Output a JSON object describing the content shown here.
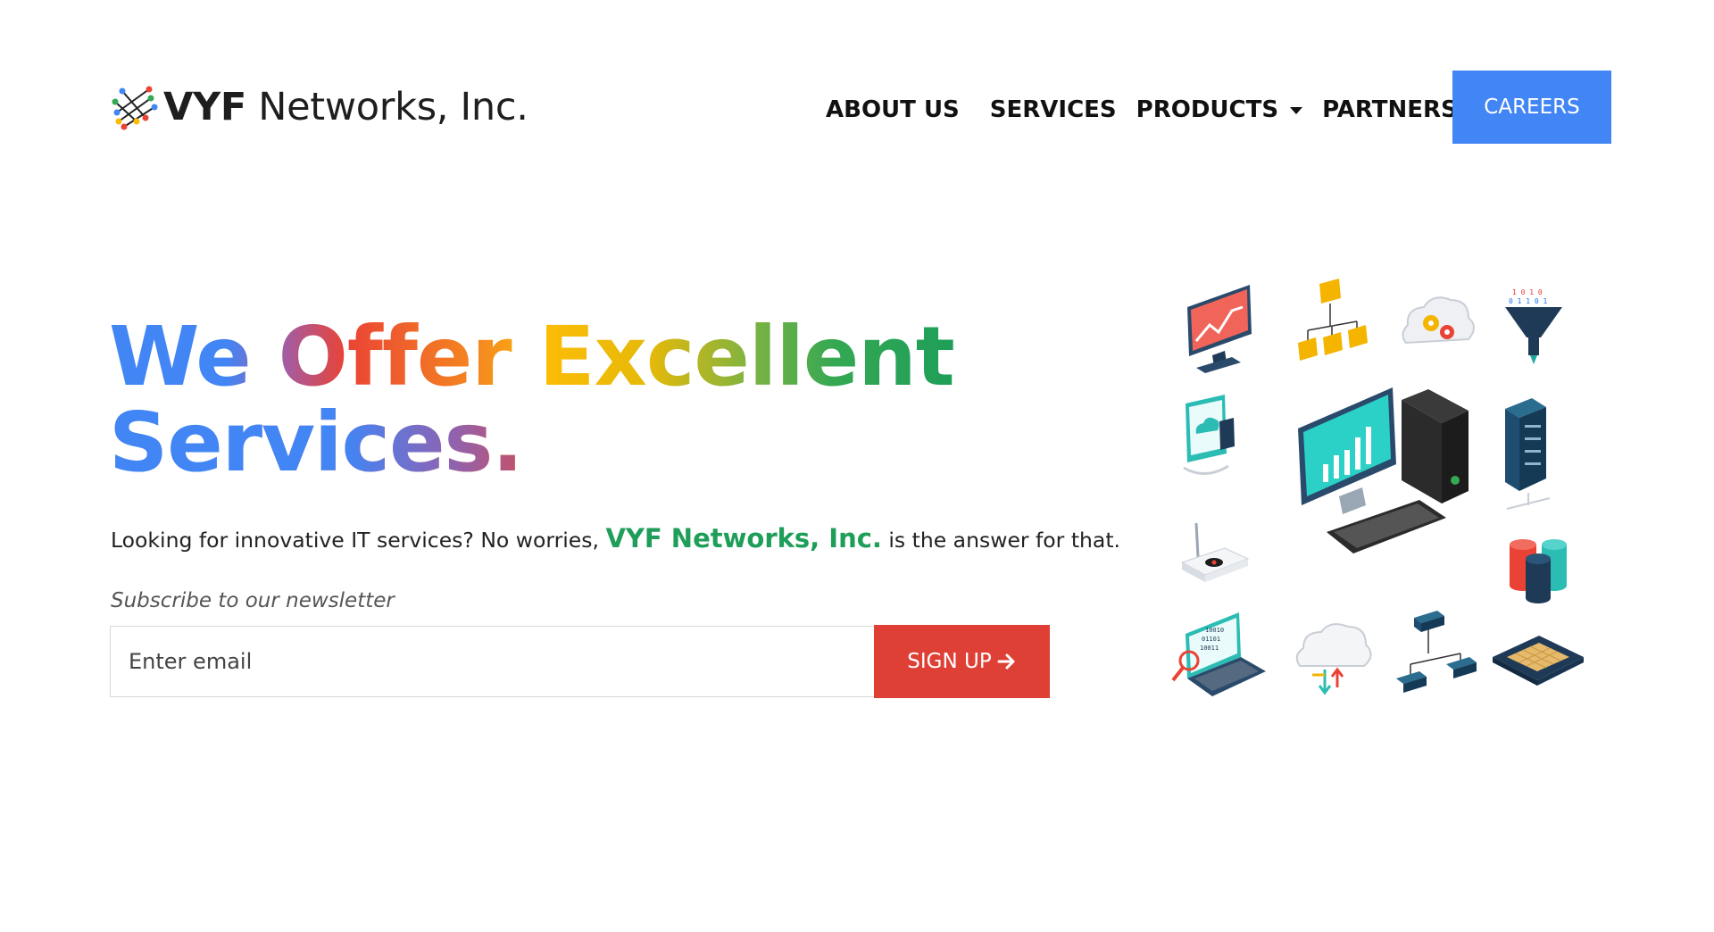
{
  "header": {
    "logo_bold": "VYF",
    "logo_rest": " Networks, Inc.",
    "nav": {
      "about": "ABOUT US",
      "services": "SERVICES",
      "products": "PRODUCTS",
      "partners": "PARTNERS"
    },
    "careers_label": "CAREERS"
  },
  "hero": {
    "headline_line1": "We Offer Excellent",
    "headline_line2": "Services.",
    "tagline_before": "Looking for innovative IT services? No worries, ",
    "tagline_brand": "VYF Networks, Inc.",
    "tagline_after": " is the answer for that.",
    "subscribe_label": "Subscribe to our newsletter",
    "email_placeholder": "Enter email",
    "signup_label": "SIGN UP"
  },
  "colors": {
    "careers_button": "#4285f4",
    "signup_button": "#df4036",
    "brand_green": "#1e9e58"
  },
  "illustration_icons": [
    "monitor-chart-icon",
    "folder-hierarchy-icon",
    "cloud-gears-icon",
    "data-funnel-icon",
    "tablet-cloud-sync-icon",
    "desktop-computer-icon",
    "server-rack-icon",
    "router-icon",
    "database-stack-icon",
    "laptop-binary-search-icon",
    "cloud-transfer-icon",
    "network-switches-icon",
    "cpu-chip-icon"
  ]
}
